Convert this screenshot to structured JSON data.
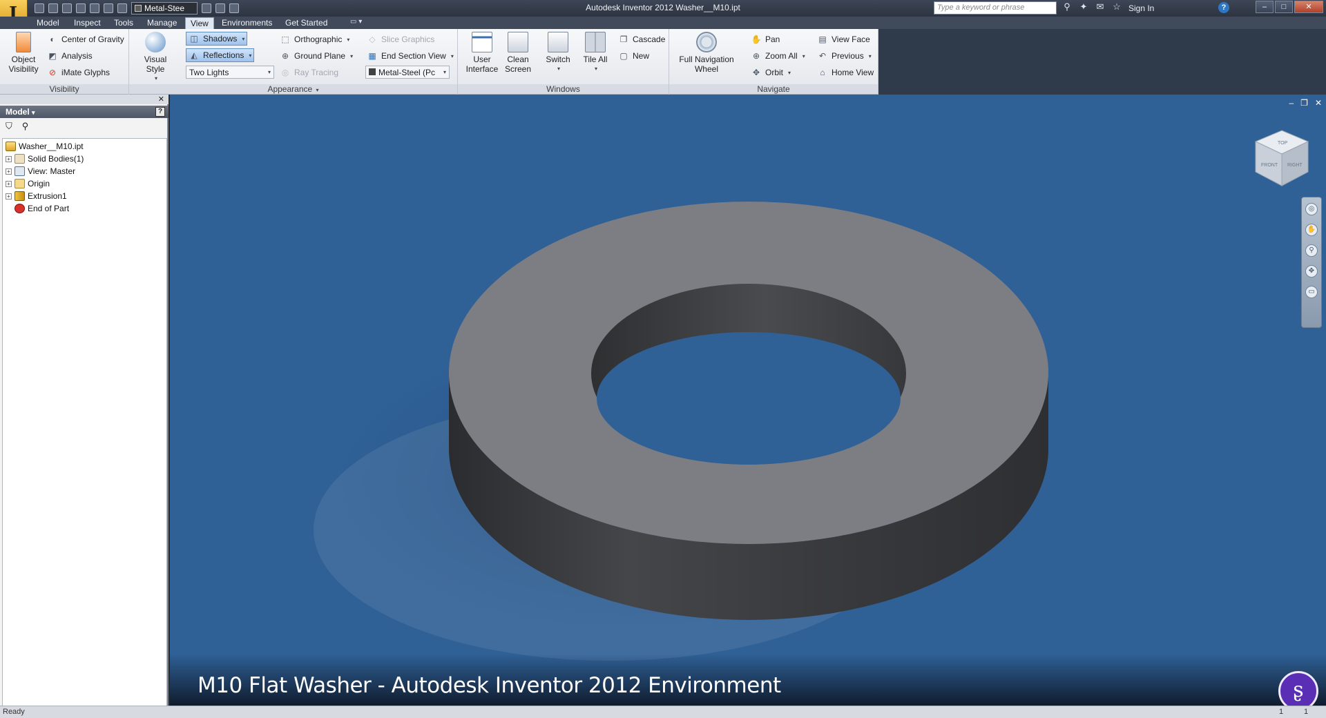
{
  "titlebar": {
    "title": "Autodesk Inventor 2012    Washer__M10.ipt",
    "material_combo": "Metal-Stee",
    "search_placeholder": "Type a keyword or phrase",
    "sign_in": "Sign In",
    "help": "?",
    "minimize": "–",
    "maximize": "□",
    "close": "✕"
  },
  "tabs": [
    "Model",
    "Inspect",
    "Tools",
    "Manage",
    "View",
    "Environments",
    "Get Started"
  ],
  "active_tab": "View",
  "ribbon": {
    "visibility": {
      "title": "Visibility",
      "object_visibility": "Object\nVisibility",
      "object_visibility_line1": "Object",
      "object_visibility_line2": "Visibility",
      "center_of_gravity": "Center of Gravity",
      "analysis": "Analysis",
      "imate_glyphs": "iMate Glyphs"
    },
    "appearance": {
      "title": "Appearance",
      "visual_style": "Visual Style",
      "shadows": "Shadows",
      "reflections": "Reflections",
      "lighting": "Two Lights",
      "orthographic": "Orthographic",
      "ground_plane": "Ground Plane",
      "ray_tracing": "Ray Tracing",
      "slice_graphics": "Slice Graphics",
      "end_section_view": "End Section View",
      "material": "Metal-Steel (Pc"
    },
    "windows": {
      "title": "Windows",
      "user_interface_line1": "User",
      "user_interface_line2": "Interface",
      "clean_screen_line1": "Clean",
      "clean_screen_line2": "Screen",
      "switch": "Switch",
      "tile_all": "Tile All",
      "cascade": "Cascade",
      "new": "New"
    },
    "navigate": {
      "title": "Navigate",
      "full_nav_line1": "Full Navigation",
      "full_nav_line2": "Wheel",
      "pan": "Pan",
      "zoom_all": "Zoom All",
      "orbit": "Orbit",
      "view_face": "View Face",
      "previous": "Previous",
      "home_view": "Home View"
    }
  },
  "browser": {
    "title": "Model",
    "help": "?",
    "tree": [
      {
        "label": "Washer__M10.ipt"
      },
      {
        "label": "Solid Bodies(1)"
      },
      {
        "label": "View: Master"
      },
      {
        "label": "Origin"
      },
      {
        "label": "Extrusion1"
      },
      {
        "label": "End of Part"
      }
    ]
  },
  "viewport": {
    "viewcube_top": "TOP",
    "viewcube_front": "FRONT",
    "viewcube_right": "RIGHT",
    "caption": "M10 Flat Washer - Autodesk Inventor 2012 Environment",
    "logo_glyph": "ʂ"
  },
  "statusbar": {
    "status": "Ready",
    "n1": "1",
    "n2": "1"
  },
  "colors": {
    "viewport_bg": "#2f6096",
    "washer_top": "#7c7d83",
    "washer_side": "#3a3b3e",
    "titlebar": "#333b48",
    "app_button": "#e9b23c"
  }
}
